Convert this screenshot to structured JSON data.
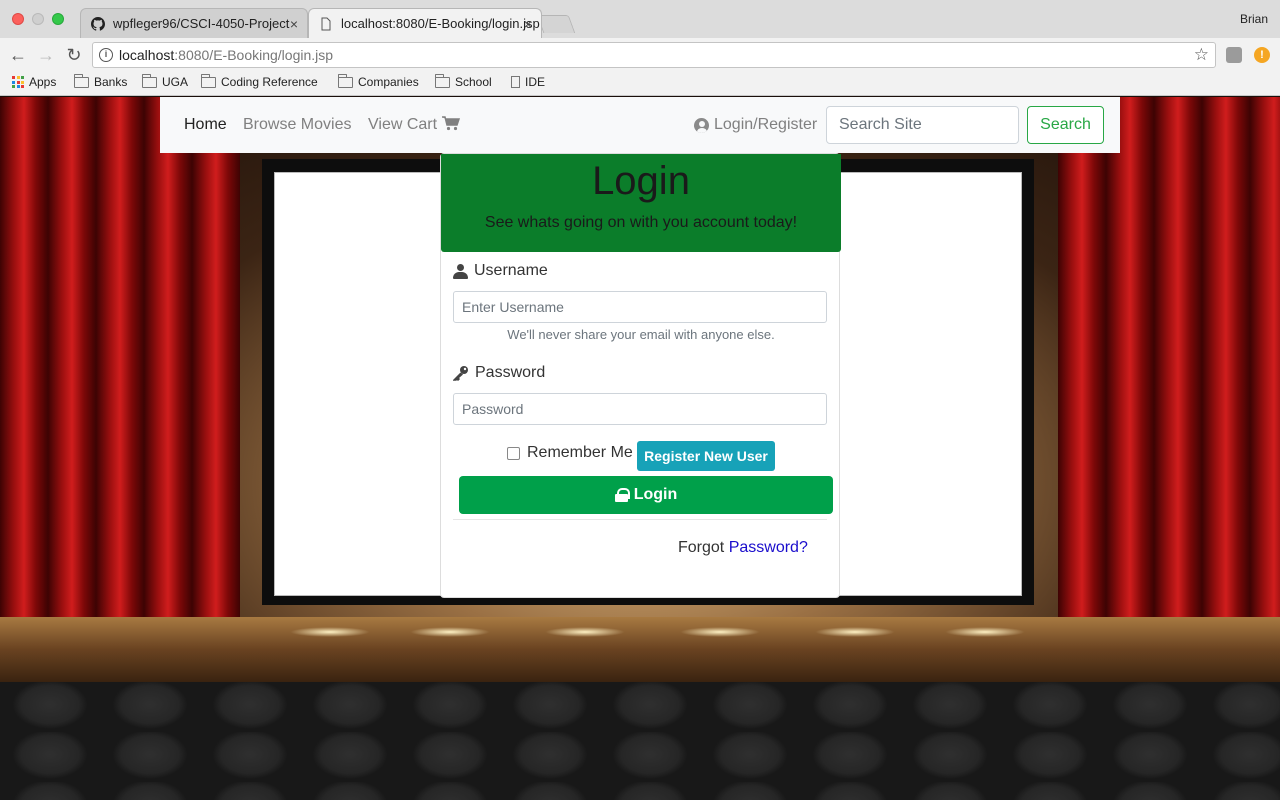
{
  "browser": {
    "tabs": [
      {
        "title": "wpfleger96/CSCI-4050-Project",
        "icon": "github-icon",
        "active": false
      },
      {
        "title": "localhost:8080/E-Booking/login.jsp",
        "icon": "document-icon",
        "active": true
      }
    ],
    "close_glyph": "×",
    "profile": "Brian",
    "url_host": "localhost",
    "url_rest": ":8080/E-Booking/login.jsp",
    "bookmarks": [
      "Apps",
      "Banks",
      "UGA",
      "Coding Reference",
      "Companies",
      "School",
      "IDE"
    ]
  },
  "navbar": {
    "home": "Home",
    "browse": "Browse Movies",
    "cart": "View Cart",
    "login_register": "Login/Register",
    "search_placeholder": "Search Site",
    "search_button": "Search"
  },
  "login": {
    "title": "Login",
    "subtitle": "See whats going on with you account today!",
    "username_label": "Username",
    "username_placeholder": "Enter Username",
    "username_help": "We'll never share your email with anyone else.",
    "password_label": "Password",
    "password_placeholder": "Password",
    "remember_label": "Remember Me",
    "remember_checked": false,
    "register_button": "Register New User",
    "login_button": "Login",
    "forgot_text": "Forgot",
    "forgot_link": "Password?"
  },
  "colors": {
    "header_green": "#0b7d2a",
    "login_button": "#00a04a",
    "register_button": "#17a2b8",
    "search_outline": "#28a745"
  }
}
